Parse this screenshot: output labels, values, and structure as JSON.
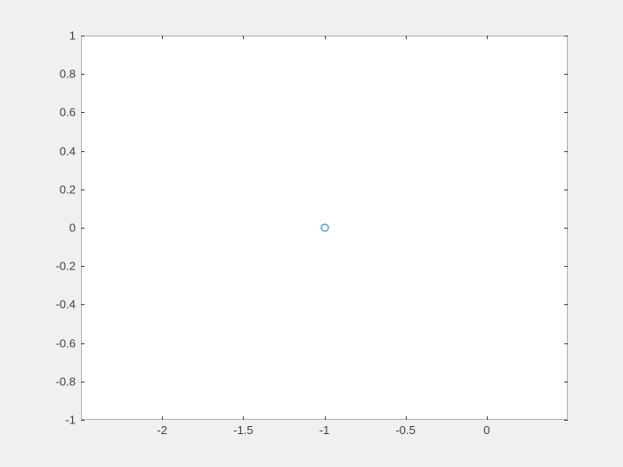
{
  "chart_data": {
    "type": "scatter",
    "x": [
      -1
    ],
    "y": [
      0
    ],
    "xlim": [
      -2.5,
      0.5
    ],
    "ylim": [
      -1,
      1
    ],
    "xticks": [
      -2,
      -1.5,
      -1,
      -0.5,
      0
    ],
    "yticks": [
      -1,
      -0.8,
      -0.6,
      -0.4,
      -0.2,
      0,
      0.2,
      0.4,
      0.6,
      0.8,
      1
    ],
    "xtick_labels": [
      "-2",
      "-1.5",
      "-1",
      "-0.5",
      "0"
    ],
    "ytick_labels": [
      "-1",
      "-0.8",
      "-0.6",
      "-0.4",
      "-0.2",
      "0",
      "0.2",
      "0.4",
      "0.6",
      "0.8",
      "1"
    ],
    "title": "",
    "xlabel": "",
    "ylabel": "",
    "marker_color": "#0072bd",
    "background": "#f0f0f0",
    "axes_bg": "#ffffff"
  },
  "layout": {
    "axes_left": 91,
    "axes_top": 40,
    "axes_width": 547,
    "axes_height": 432
  }
}
